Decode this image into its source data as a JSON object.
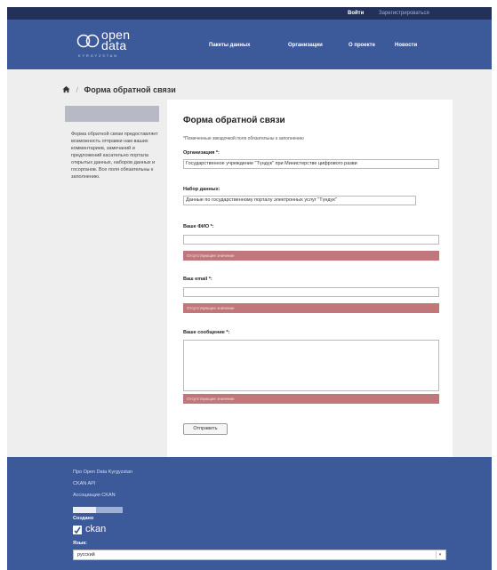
{
  "account": {
    "login": "Войти",
    "register": "Зарегистрироваться"
  },
  "logo": {
    "line1": "open",
    "line2": "data",
    "sub": "KYRGYZSTAN"
  },
  "nav": [
    {
      "label": "Пакеты данных"
    },
    {
      "label": "Организации"
    },
    {
      "label": "О проекте"
    },
    {
      "label": "Новости"
    }
  ],
  "breadcrumb": {
    "current": "Форма обратной связи"
  },
  "sidebar": {
    "text": "Форма обратной связи предоставляет возможность отправки нам ваших комментариев, замечаний и предложений касательно портала открытых данных, наборов данных и госорганов. Все поля обязательны к заполнению."
  },
  "form": {
    "title": "Форма обратной связи",
    "note": "*Помеченные звездочкой поля обязательны к заполнению",
    "org_label": "Организация *:",
    "org_value": "Государственное учреждение \"Түндүк\" при Министерстве цифрового разви",
    "dataset_label": "Набор данных:",
    "dataset_value": "Данные по государственному порталу электронных услуг \"Түндүк\"",
    "name_label": "Ваше ФИО *:",
    "name_value": "",
    "email_label": "Ваш email *:",
    "email_value": "",
    "message_label": "Ваше сообщение *:",
    "error_text": "Отсутствующее значение",
    "submit": "Отправить"
  },
  "footer": {
    "about": "Про Open Data Kyrgyzstan",
    "api": "CKAN API",
    "association": "Ассоциация CKAN",
    "created_label": "Создано",
    "ckan_word": "ckan",
    "lang_label": "Язык:",
    "lang_value": "русский"
  },
  "colors": {
    "header_bg": "#3c5a9a",
    "top_strip": "#22305a",
    "error_bg": "#c1767a",
    "content_bg": "#eeeeee"
  }
}
